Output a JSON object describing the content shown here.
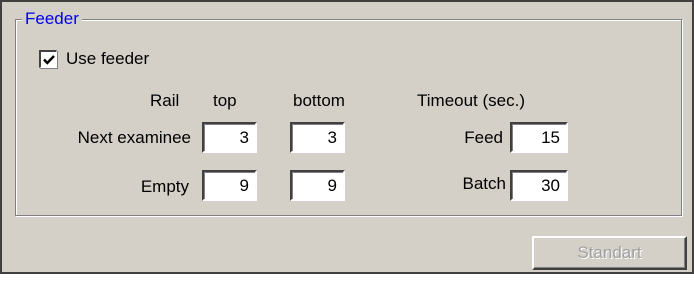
{
  "group": {
    "title": "Feeder"
  },
  "use_feeder": {
    "label": "Use feeder",
    "checked": true
  },
  "headers": {
    "rail": "Rail",
    "top": "top",
    "bottom": "bottom",
    "timeout": "Timeout (sec.)"
  },
  "rows": {
    "next_examinee": {
      "label": "Next examinee",
      "top": "3",
      "bottom": "3"
    },
    "empty": {
      "label": "Empty",
      "top": "9",
      "bottom": "9"
    }
  },
  "timeouts": {
    "feed": {
      "label": "Feed",
      "value": "15"
    },
    "batch": {
      "label": "Batch",
      "value": "30"
    }
  },
  "buttons": {
    "standart": "Standart"
  }
}
